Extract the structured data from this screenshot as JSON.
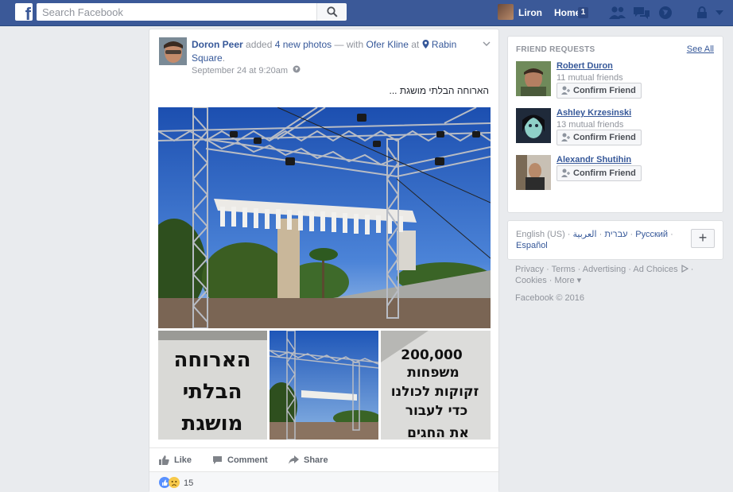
{
  "topbar": {
    "search_placeholder": "Search Facebook",
    "user_name": "Liron",
    "home_label": "Home",
    "home_count": "1",
    "brand_color": "#3b5998"
  },
  "post": {
    "author": "Doron Peer",
    "action_text": "added",
    "photo_count_link": "4 new photos",
    "with_text": "— with",
    "tagged": "Ofer Kline",
    "at_text": "at",
    "location": "Rabin Square",
    "time": "September 24 at 9:20am",
    "text": "הארוחה הבלתי מושגת ...",
    "photos": [
      {
        "name": "stage-structure-wide",
        "caption_lines": []
      },
      {
        "name": "sign-harucha",
        "caption_lines": [
          "הארוחה",
          "הבלתי",
          "מושגת"
        ]
      },
      {
        "name": "stage-structure-small",
        "caption_lines": []
      },
      {
        "name": "sign-200000",
        "caption_lines": [
          "200,000",
          "משפחות",
          "זקוקות לכולנו",
          "כדי לעבור",
          "את החגים"
        ]
      }
    ],
    "actions": {
      "like": "Like",
      "comment": "Comment",
      "share": "Share"
    },
    "reaction_count": "15"
  },
  "friend_requests": {
    "title": "FRIEND REQUESTS",
    "see_all": "See All",
    "items": [
      {
        "name": "Robert Duron",
        "mutual": "11 mutual friends",
        "button": "Confirm Friend"
      },
      {
        "name": "Ashley Krzesinski",
        "mutual": "13 mutual friends",
        "button": "Confirm Friend"
      },
      {
        "name": "Alexandr Shutihin",
        "mutual": "",
        "button": "Confirm Friend"
      }
    ]
  },
  "languages": {
    "current": "English (US)",
    "options": [
      "עברית",
      "العربية",
      "Русский",
      "Español"
    ],
    "add": "+"
  },
  "footer": {
    "links": [
      "Privacy",
      "Terms",
      "Advertising",
      "Ad Choices",
      "Cookies",
      "More"
    ],
    "copyright": "Facebook © 2016"
  }
}
